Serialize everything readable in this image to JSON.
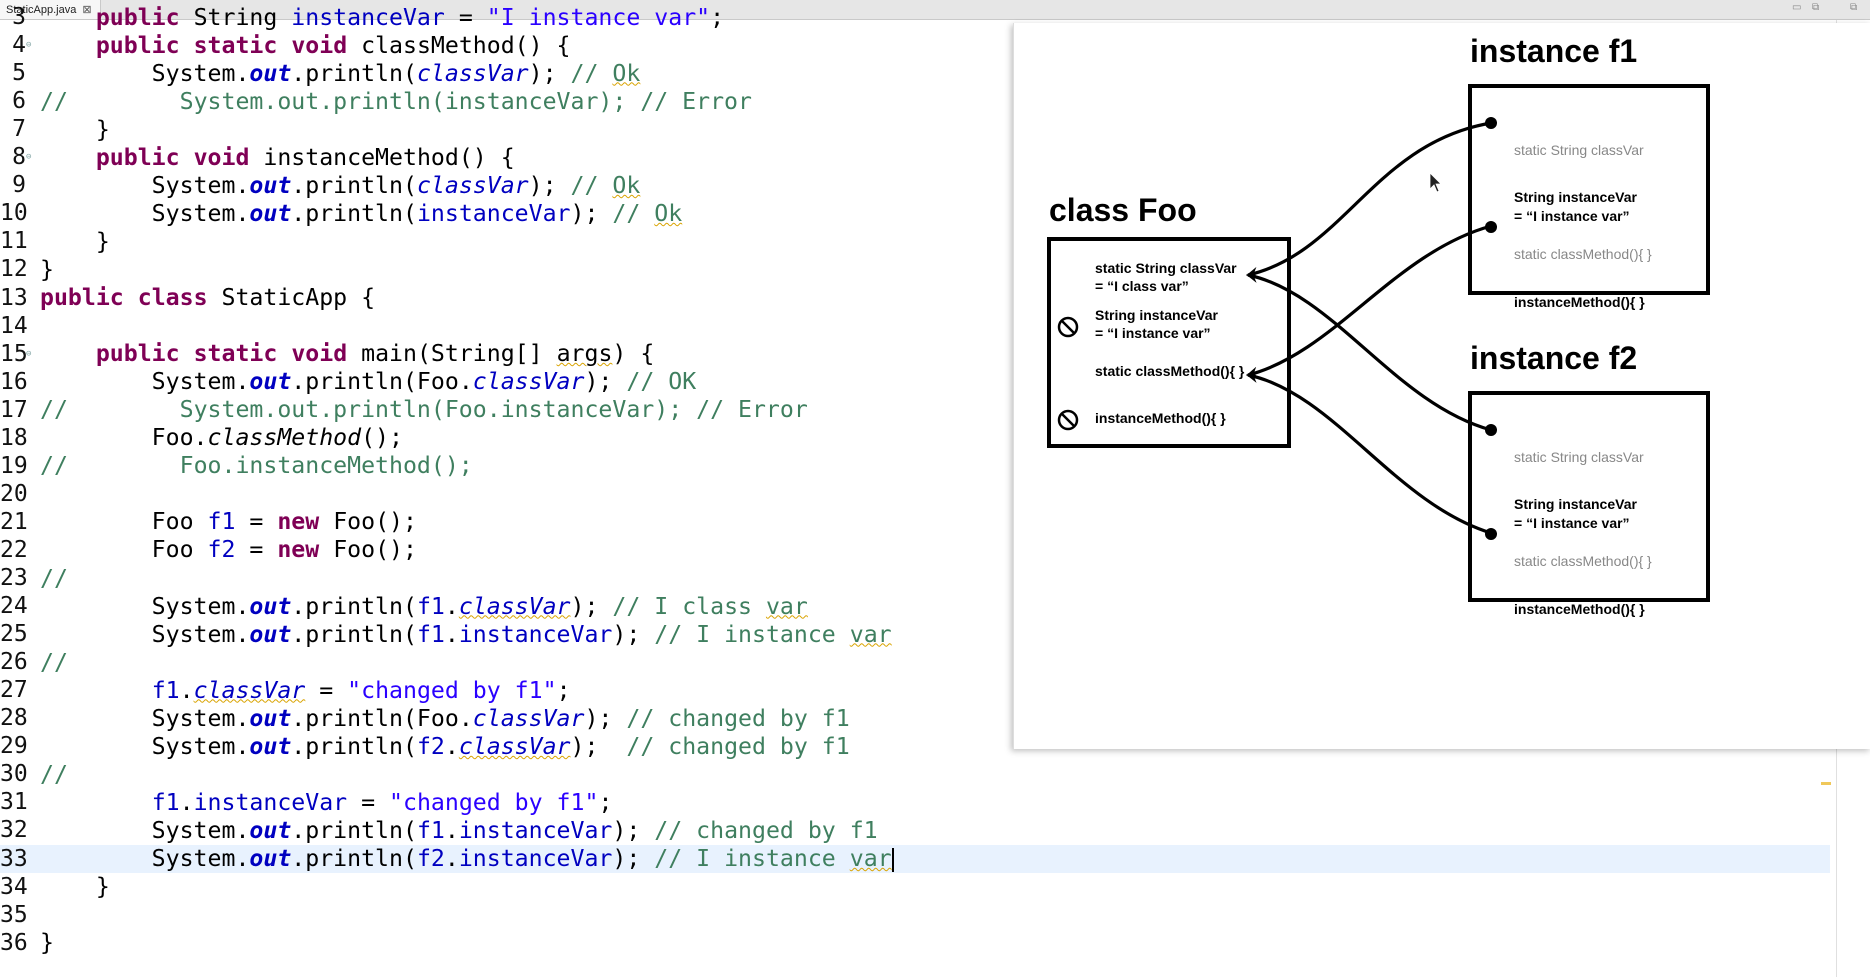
{
  "tab": {
    "title": "StaticApp.java",
    "close": "⊠"
  },
  "code": [
    {
      "n": "3",
      "fold": false,
      "current": false,
      "tokens": [
        [
          "    ",
          ""
        ],
        [
          "public",
          "kw"
        ],
        [
          " String ",
          ""
        ],
        [
          "instanceVar",
          "fld"
        ],
        [
          " = ",
          ""
        ],
        [
          "\"I instance var\"",
          "str"
        ],
        [
          ";",
          ""
        ]
      ]
    },
    {
      "n": "4",
      "fold": true,
      "current": false,
      "tokens": [
        [
          "    ",
          ""
        ],
        [
          "public",
          "kw"
        ],
        [
          " ",
          ""
        ],
        [
          "static",
          "kw"
        ],
        [
          " ",
          ""
        ],
        [
          "void",
          "kw"
        ],
        [
          " classMethod() {",
          ""
        ]
      ]
    },
    {
      "n": "5",
      "fold": false,
      "current": false,
      "tokens": [
        [
          "        System.",
          ""
        ],
        [
          "out",
          "out"
        ],
        [
          ".println(",
          ""
        ],
        [
          "classVar",
          "fld static"
        ],
        [
          "); ",
          ""
        ],
        [
          "// ",
          "cm"
        ],
        [
          "Ok",
          "cm sq"
        ]
      ]
    },
    {
      "n": "6",
      "fold": false,
      "current": false,
      "tokens": [
        [
          "// ",
          "cm"
        ],
        [
          "       System.out.println(instanceVar); // Error",
          "cm"
        ]
      ]
    },
    {
      "n": "7",
      "fold": false,
      "current": false,
      "tokens": [
        [
          "    }",
          ""
        ]
      ]
    },
    {
      "n": "8",
      "fold": true,
      "current": false,
      "tokens": [
        [
          "    ",
          ""
        ],
        [
          "public",
          "kw"
        ],
        [
          " ",
          ""
        ],
        [
          "void",
          "kw"
        ],
        [
          " instanceMethod() {",
          ""
        ]
      ]
    },
    {
      "n": "9",
      "fold": false,
      "current": false,
      "tokens": [
        [
          "        System.",
          ""
        ],
        [
          "out",
          "out"
        ],
        [
          ".println(",
          ""
        ],
        [
          "classVar",
          "fld static"
        ],
        [
          "); ",
          ""
        ],
        [
          "// ",
          "cm"
        ],
        [
          "Ok",
          "cm sq"
        ]
      ]
    },
    {
      "n": "10",
      "fold": false,
      "current": false,
      "tokens": [
        [
          "        System.",
          ""
        ],
        [
          "out",
          "out"
        ],
        [
          ".println(",
          ""
        ],
        [
          "instanceVar",
          "fld"
        ],
        [
          "); ",
          ""
        ],
        [
          "// ",
          "cm"
        ],
        [
          "Ok",
          "cm sq"
        ]
      ]
    },
    {
      "n": "11",
      "fold": false,
      "current": false,
      "tokens": [
        [
          "    }",
          ""
        ]
      ]
    },
    {
      "n": "12",
      "fold": false,
      "current": false,
      "tokens": [
        [
          "}",
          ""
        ]
      ]
    },
    {
      "n": "13",
      "fold": false,
      "current": false,
      "tokens": [
        [
          "public",
          "kw"
        ],
        [
          " ",
          ""
        ],
        [
          "class",
          "kw"
        ],
        [
          " StaticApp {",
          ""
        ]
      ]
    },
    {
      "n": "14",
      "fold": false,
      "current": false,
      "tokens": []
    },
    {
      "n": "15",
      "fold": true,
      "current": false,
      "tokens": [
        [
          "    ",
          ""
        ],
        [
          "public",
          "kw"
        ],
        [
          " ",
          ""
        ],
        [
          "static",
          "kw"
        ],
        [
          " ",
          ""
        ],
        [
          "void",
          "kw"
        ],
        [
          " main(String[] ",
          ""
        ],
        [
          "args",
          "sq"
        ],
        [
          ") {",
          ""
        ]
      ]
    },
    {
      "n": "16",
      "fold": false,
      "current": false,
      "tokens": [
        [
          "        System.",
          ""
        ],
        [
          "out",
          "out"
        ],
        [
          ".println(Foo.",
          ""
        ],
        [
          "classVar",
          "fld static"
        ],
        [
          "); ",
          ""
        ],
        [
          "// OK",
          "cm"
        ]
      ]
    },
    {
      "n": "17",
      "fold": false,
      "current": false,
      "tokens": [
        [
          "// ",
          "cm"
        ],
        [
          "       System.out.println(Foo.instanceVar); // Error",
          "cm"
        ]
      ]
    },
    {
      "n": "18",
      "fold": false,
      "current": false,
      "tokens": [
        [
          "        Foo.",
          ""
        ],
        [
          "classMethod",
          "smeth"
        ],
        [
          "();",
          ""
        ]
      ]
    },
    {
      "n": "19",
      "fold": false,
      "current": false,
      "tokens": [
        [
          "// ",
          "cm"
        ],
        [
          "       Foo.instanceMethod();",
          "cm"
        ]
      ]
    },
    {
      "n": "20",
      "fold": false,
      "current": false,
      "tokens": []
    },
    {
      "n": "21",
      "fold": false,
      "current": false,
      "tokens": [
        [
          "        Foo ",
          ""
        ],
        [
          "f1",
          "fld"
        ],
        [
          " = ",
          ""
        ],
        [
          "new",
          "kw"
        ],
        [
          " Foo();",
          ""
        ]
      ]
    },
    {
      "n": "22",
      "fold": false,
      "current": false,
      "tokens": [
        [
          "        Foo ",
          ""
        ],
        [
          "f2",
          "fld"
        ],
        [
          " = ",
          ""
        ],
        [
          "new",
          "kw"
        ],
        [
          " Foo();",
          ""
        ]
      ]
    },
    {
      "n": "23",
      "fold": false,
      "current": false,
      "tokens": [
        [
          "//",
          "cm"
        ]
      ]
    },
    {
      "n": "24",
      "fold": false,
      "current": false,
      "tokens": [
        [
          "        System.",
          ""
        ],
        [
          "out",
          "out"
        ],
        [
          ".println(",
          ""
        ],
        [
          "f1",
          "fld"
        ],
        [
          ".",
          ""
        ],
        [
          "classVar",
          "fld static sq"
        ],
        [
          "); ",
          ""
        ],
        [
          "// I class ",
          "cm"
        ],
        [
          "var",
          "cm sq"
        ]
      ]
    },
    {
      "n": "25",
      "fold": false,
      "current": false,
      "tokens": [
        [
          "        System.",
          ""
        ],
        [
          "out",
          "out"
        ],
        [
          ".println(",
          ""
        ],
        [
          "f1",
          "fld"
        ],
        [
          ".",
          ""
        ],
        [
          "instanceVar",
          "fld"
        ],
        [
          "); ",
          ""
        ],
        [
          "// I instance ",
          "cm"
        ],
        [
          "var",
          "cm sq"
        ]
      ]
    },
    {
      "n": "26",
      "fold": false,
      "current": false,
      "tokens": [
        [
          "//",
          "cm"
        ]
      ]
    },
    {
      "n": "27",
      "fold": false,
      "current": false,
      "tokens": [
        [
          "        ",
          ""
        ],
        [
          "f1",
          "fld"
        ],
        [
          ".",
          ""
        ],
        [
          "classVar",
          "fld static sq"
        ],
        [
          " = ",
          ""
        ],
        [
          "\"changed by f1\"",
          "str"
        ],
        [
          ";",
          ""
        ]
      ]
    },
    {
      "n": "28",
      "fold": false,
      "current": false,
      "tokens": [
        [
          "        System.",
          ""
        ],
        [
          "out",
          "out"
        ],
        [
          ".println(Foo.",
          ""
        ],
        [
          "classVar",
          "fld static"
        ],
        [
          "); ",
          ""
        ],
        [
          "// changed by f1",
          "cm"
        ]
      ]
    },
    {
      "n": "29",
      "fold": false,
      "current": false,
      "tokens": [
        [
          "        System.",
          ""
        ],
        [
          "out",
          "out"
        ],
        [
          ".println(",
          ""
        ],
        [
          "f2",
          "fld"
        ],
        [
          ".",
          ""
        ],
        [
          "classVar",
          "fld static sq"
        ],
        [
          ");  ",
          ""
        ],
        [
          "// changed by f1",
          "cm"
        ]
      ]
    },
    {
      "n": "30",
      "fold": false,
      "current": false,
      "tokens": [
        [
          "//",
          "cm"
        ]
      ]
    },
    {
      "n": "31",
      "fold": false,
      "current": false,
      "tokens": [
        [
          "        ",
          ""
        ],
        [
          "f1",
          "fld"
        ],
        [
          ".",
          ""
        ],
        [
          "instanceVar",
          "fld"
        ],
        [
          " = ",
          ""
        ],
        [
          "\"changed by f1\"",
          "str"
        ],
        [
          ";",
          ""
        ]
      ]
    },
    {
      "n": "32",
      "fold": false,
      "current": false,
      "tokens": [
        [
          "        System.",
          ""
        ],
        [
          "out",
          "out"
        ],
        [
          ".println(",
          ""
        ],
        [
          "f1",
          "fld"
        ],
        [
          ".",
          ""
        ],
        [
          "instanceVar",
          "fld"
        ],
        [
          "); ",
          ""
        ],
        [
          "// changed by f1",
          "cm"
        ]
      ]
    },
    {
      "n": "33",
      "fold": false,
      "current": true,
      "tokens": [
        [
          "        System.",
          ""
        ],
        [
          "out",
          "out"
        ],
        [
          ".println(",
          ""
        ],
        [
          "f2",
          "fld"
        ],
        [
          ".",
          ""
        ],
        [
          "instanceVar",
          "fld"
        ],
        [
          "); ",
          ""
        ],
        [
          "// I instance ",
          "cm"
        ],
        [
          "var",
          "cm sq"
        ]
      ]
    },
    {
      "n": "34",
      "fold": false,
      "current": false,
      "tokens": [
        [
          "    }",
          ""
        ]
      ]
    },
    {
      "n": "35",
      "fold": false,
      "current": false,
      "tokens": []
    },
    {
      "n": "36",
      "fold": false,
      "current": false,
      "tokens": [
        [
          "}",
          ""
        ]
      ]
    }
  ],
  "diagram": {
    "class_title": "class Foo",
    "class_rows": [
      {
        "lines": [
          "static String classVar",
          "= “I class var”"
        ],
        "blocked": false
      },
      {
        "lines": [
          "String instanceVar",
          "= “I instance var”"
        ],
        "blocked": true
      },
      {
        "lines": [
          "static classMethod(){    }"
        ],
        "blocked": false
      },
      {
        "lines": [
          "instanceMethod(){    }"
        ],
        "blocked": true
      }
    ],
    "instances": [
      {
        "title": "instance f1"
      },
      {
        "title": "instance f2"
      }
    ],
    "instance_rows": [
      {
        "lines": [
          "static String classVar"
        ],
        "faded": true
      },
      {
        "lines": [
          "String instanceVar",
          "= “I instance var”"
        ],
        "faded": false
      },
      {
        "lines": [
          "static classMethod(){    }"
        ],
        "faded": true
      },
      {
        "lines": [
          "instanceMethod(){    }"
        ],
        "faded": false
      }
    ]
  }
}
